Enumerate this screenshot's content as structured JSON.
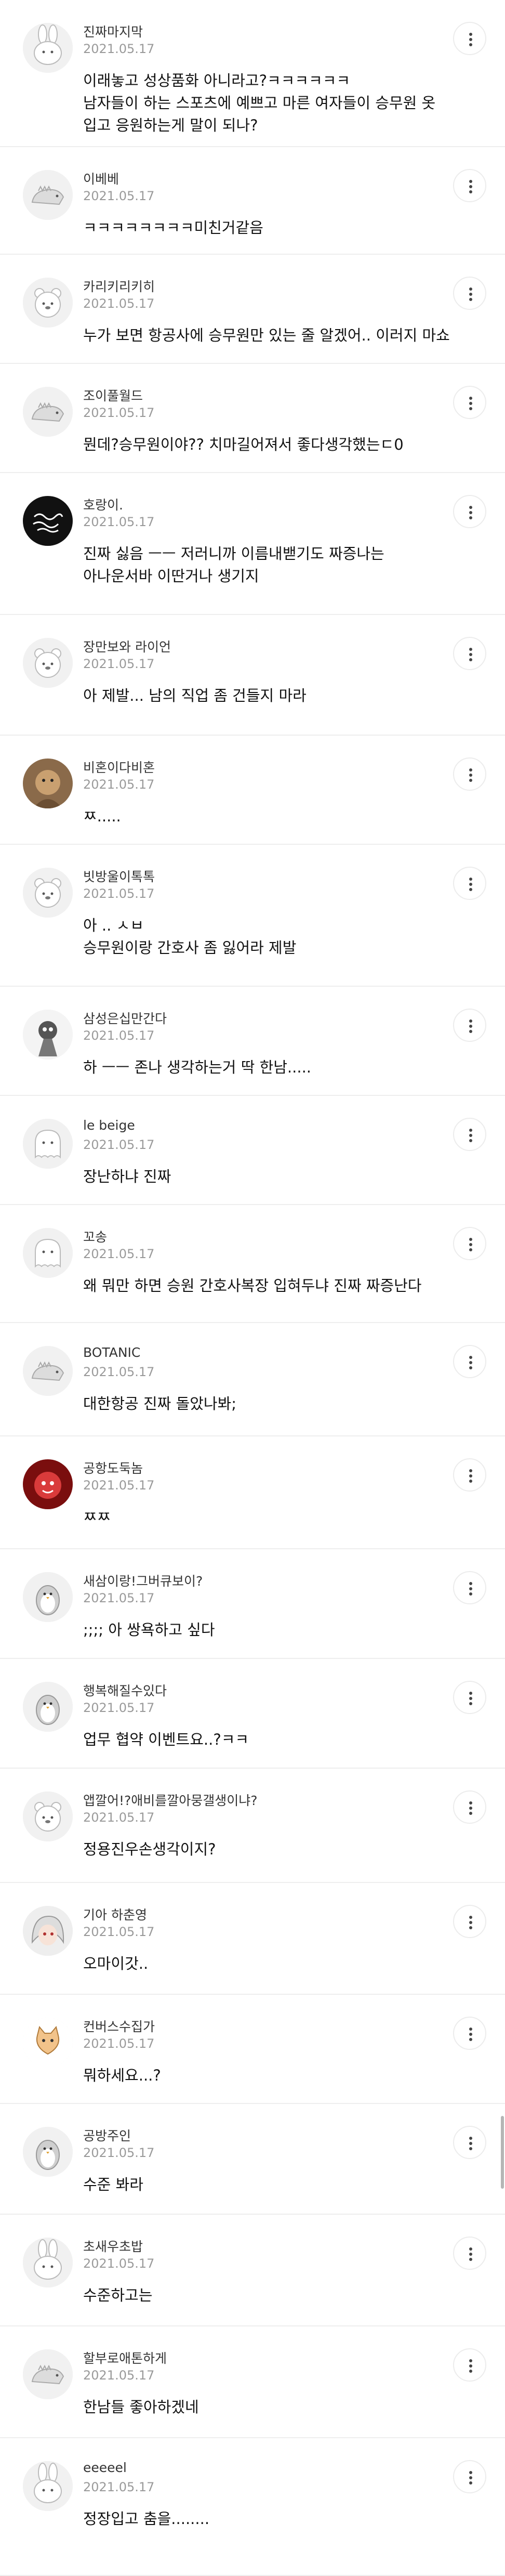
{
  "comments": [
    {
      "author": "진짜마지막",
      "date": "2021.05.17",
      "text": "이래놓고 성상품화 아니라고?ㅋㅋㅋㅋㅋㅋ\n남자들이 하는 스포츠에 예쁘고 마른 여자들이 승무원 옷\n입고 응원하는게 말이 되나?",
      "avatar": "bunny"
    },
    {
      "author": "이베베",
      "date": "2021.05.17",
      "text": "ㅋㅋㅋㅋㅋㅋㅋㅋ미친거같음",
      "avatar": "dino"
    },
    {
      "author": "카리키리키히",
      "date": "2021.05.17",
      "text": "누가 보면 항공사에 승무원만 있는 줄 알겠어.. 이러지 마쇼",
      "avatar": "bear"
    },
    {
      "author": "조이풀월드",
      "date": "2021.05.17",
      "text": "뭔데?승무원이야?? 치마길어져서 좋다생각했는ㄷ0",
      "avatar": "dino"
    },
    {
      "author": "호랑이.",
      "date": "2021.05.17",
      "text": "진짜 싫음 ㅡㅡ 저러니까 이름내밷기도 짜증나는\n아나운서바 이딴거나 생기지",
      "avatar": "black"
    },
    {
      "author": "장만보와 라이언",
      "date": "2021.05.17",
      "text": "아 제발... 남의 직업 좀 건들지 마라",
      "avatar": "bear"
    },
    {
      "author": "비혼이다비혼",
      "date": "2021.05.17",
      "text": "ㅉ.....",
      "avatar": "photo"
    },
    {
      "author": "빗방울이톡톡",
      "date": "2021.05.17",
      "text": "아 .. ㅅㅂ\n승무원이랑 간호사 좀 잃어라 제발",
      "avatar": "bear"
    },
    {
      "author": "삼성은십만간다",
      "date": "2021.05.17",
      "text": "하 ㅡㅡ 존나 생각하는거 딱 한남.....",
      "avatar": "cartoon"
    },
    {
      "author": "le beige",
      "date": "2021.05.17",
      "text": "장난하냐 진짜",
      "avatar": "ghost"
    },
    {
      "author": "꼬송",
      "date": "2021.05.17",
      "text": "왜 뭐만 하면 승원 간호사복장 입혀두냐 진짜 짜증난다",
      "avatar": "ghost"
    },
    {
      "author": "BOTANIC",
      "date": "2021.05.17",
      "text": "대한항공 진짜 돌았나봐;",
      "avatar": "dino"
    },
    {
      "author": "공항도둑놈",
      "date": "2021.05.17",
      "text": "ㅉㅉ",
      "avatar": "red"
    },
    {
      "author": "새삼이랑!그버큐보이?",
      "date": "2021.05.17",
      "text": ";;;; 아 쌍욕하고 싶다",
      "avatar": "penguin"
    },
    {
      "author": "행복해질수있다",
      "date": "2021.05.17",
      "text": "업무 협약 이벤트요..?ㅋㅋ",
      "avatar": "penguin"
    },
    {
      "author": "앱깔어!?애비를깔아뭉갤생이냐?",
      "date": "2021.05.17",
      "text": "정용진우손생각이지?",
      "avatar": "bear"
    },
    {
      "author": "기아 하춘영",
      "date": "2021.05.17",
      "text": "오마이갓..",
      "avatar": "anime"
    },
    {
      "author": "컨버스수집가",
      "date": "2021.05.17",
      "text": "뭐하세요...?",
      "avatar": "cat"
    },
    {
      "author": "공방주인",
      "date": "2021.05.17",
      "text": "수준 봐라",
      "avatar": "penguin"
    },
    {
      "author": "초새우초밥",
      "date": "2021.05.17",
      "text": "수준하고는",
      "avatar": "bunny"
    },
    {
      "author": "할부로애톤하게",
      "date": "2021.05.17",
      "text": "한남들 좋아하겠네",
      "avatar": "dino"
    },
    {
      "author": "eeeeel",
      "date": "2021.05.17",
      "text": "정장입고 춤을........",
      "avatar": "bunny"
    }
  ]
}
